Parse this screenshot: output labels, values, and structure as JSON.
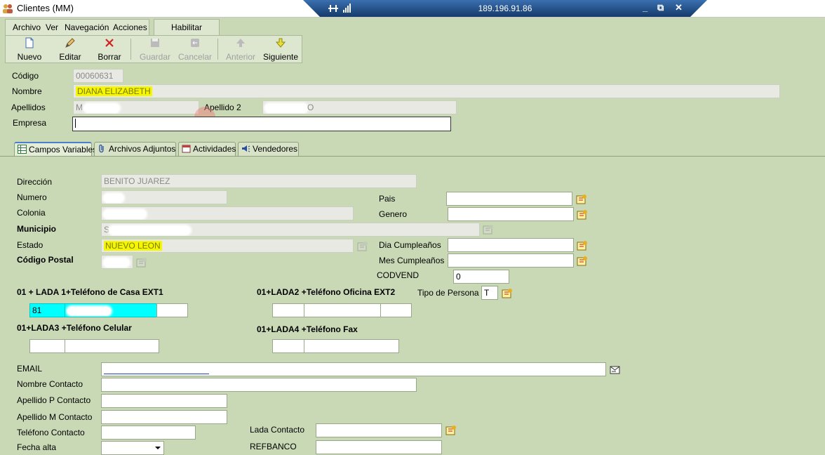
{
  "window": {
    "title": "Clientes (MM)"
  },
  "remote": {
    "ip": "189.196.91.86",
    "minimize": "_",
    "restore": "⧉",
    "close": "✕"
  },
  "menu": {
    "archivo": "Archivo",
    "ver": "Ver",
    "navegacion": "Navegación",
    "acciones": "Acciones",
    "habilitar": "Habilitar Cambios"
  },
  "toolbar": {
    "nuevo": "Nuevo",
    "editar": "Editar",
    "borrar": "Borrar",
    "guardar": "Guardar",
    "cancelar": "Cancelar",
    "anterior": "Anterior",
    "siguiente": "Siguiente"
  },
  "header": {
    "codigo_label": "Código",
    "codigo_value": "00060631",
    "nombre_label": "Nombre",
    "nombre_value": "DIANA ELIZABETH",
    "apellidos_label": "Apellidos",
    "apellido1_value": "M",
    "apellido2_label": "Apellido 2",
    "apellido2_value": "O",
    "empresa_label": "Empresa",
    "empresa_value": ""
  },
  "tabs": [
    {
      "label": "Campos Variables"
    },
    {
      "label": "Archivos Adjuntos"
    },
    {
      "label": "Actividades"
    },
    {
      "label": "Vendedores"
    }
  ],
  "form": {
    "direccion_label": "Dirección",
    "direccion_value": "BENITO JUAREZ",
    "numero_label": "Numero",
    "colonia_label": "Colonia",
    "municipio_label": "Municipio",
    "municipio_value": "S",
    "estado_label": "Estado",
    "estado_value": "NUEVO LEON",
    "cp_label": "Código Postal",
    "pais_label": "Pais",
    "genero_label": "Genero",
    "dia_label": "Dia Cumpleaños",
    "mes_label": "Mes Cumpleaños",
    "codvend_label": "CODVEND",
    "codvend_value": "0",
    "tipo_label": "Tipo de Persona",
    "tipo_value": "T",
    "tel_casa_label": "01 + LADA 1+Teléfono de Casa   EXT1",
    "tel_casa_lada": "81",
    "tel_oficina_label": "01+LADA2 +Teléfono Oficina   EXT2",
    "tel_celular_label": "01+LADA3 +Teléfono Celular",
    "tel_fax_label": "01+LADA4  +Teléfono Fax",
    "email_label": "EMAIL",
    "nombre_contacto_label": "Nombre Contacto",
    "apellido_p_label": "Apellido P Contacto",
    "apellido_m_label": "Apellido M Contacto",
    "telefono_contacto_label": "Teléfono Contacto",
    "lada_contacto_label": "Lada Contacto",
    "fecha_alta_label": "Fecha alta",
    "refbanco_label": "REFBANCO"
  },
  "colors": {
    "background": "#c9d9b5",
    "remote_bar": "#1f4f8a",
    "highlight": "#f6f600",
    "phone_highlight": "#00ffff"
  }
}
